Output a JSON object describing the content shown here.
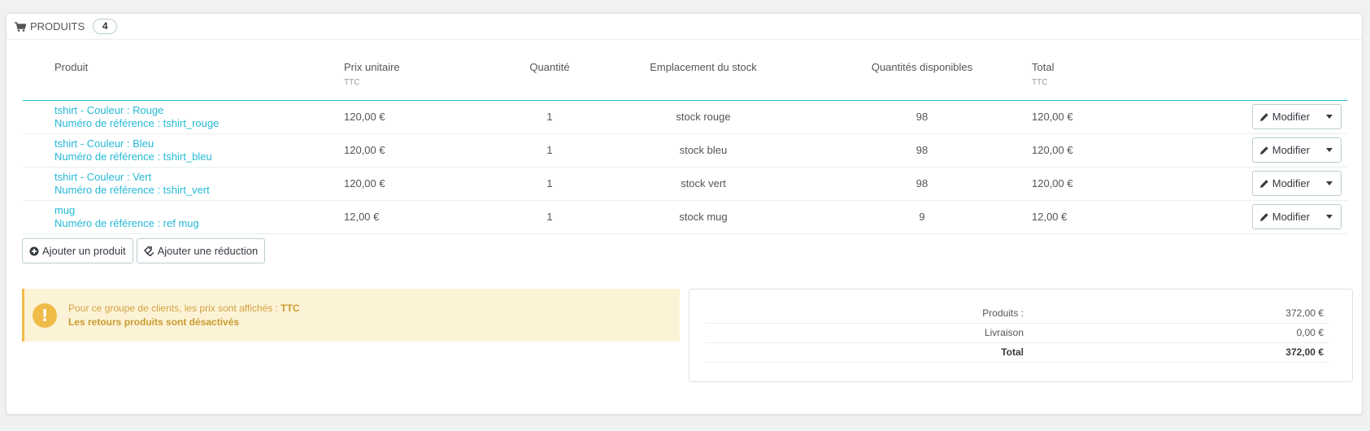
{
  "header": {
    "title": "Produits",
    "count": "4"
  },
  "columns": {
    "product": "Produit",
    "unit_price": "Prix unitaire",
    "unit_price_sub": "TTC",
    "quantity": "Quantité",
    "location": "Emplacement du stock",
    "available": "Quantités disponibles",
    "total": "Total",
    "total_sub": "TTC"
  },
  "rows": [
    {
      "name": "tshirt - Couleur : Rouge",
      "ref": "Numéro de référence : tshirt_rouge",
      "price": "120,00 €",
      "qty": "1",
      "location": "stock rouge",
      "available": "98",
      "total": "120,00 €",
      "action": "Modifier"
    },
    {
      "name": "tshirt - Couleur : Bleu",
      "ref": "Numéro de référence : tshirt_bleu",
      "price": "120,00 €",
      "qty": "1",
      "location": "stock bleu",
      "available": "98",
      "total": "120,00 €",
      "action": "Modifier"
    },
    {
      "name": "tshirt - Couleur : Vert",
      "ref": "Numéro de référence : tshirt_vert",
      "price": "120,00 €",
      "qty": "1",
      "location": "stock vert",
      "available": "98",
      "total": "120,00 €",
      "action": "Modifier"
    },
    {
      "name": "mug",
      "ref": "Numéro de référence : ref mug",
      "price": "12,00 €",
      "qty": "1",
      "location": "stock mug",
      "available": "9",
      "total": "12,00 €",
      "action": "Modifier"
    }
  ],
  "buttons": {
    "add_product": "Ajouter un produit",
    "add_discount": "Ajouter une réduction"
  },
  "alert": {
    "line1": "Pour ce groupe de clients, les prix sont affichés : ",
    "line1_bold": "TTC",
    "line2": "Les retours produits sont désactivés",
    "icon": "exclamation-icon"
  },
  "summary": {
    "products_label": "Produits :",
    "products_value": "372,00 €",
    "shipping_label": "Livraison",
    "shipping_value": "0,00 €",
    "total_label": "Total",
    "total_value": "372,00 €"
  },
  "colors": {
    "accent": "#25b9d7",
    "warning": "#f0bc48",
    "warning_bg": "#fcf3d6"
  }
}
